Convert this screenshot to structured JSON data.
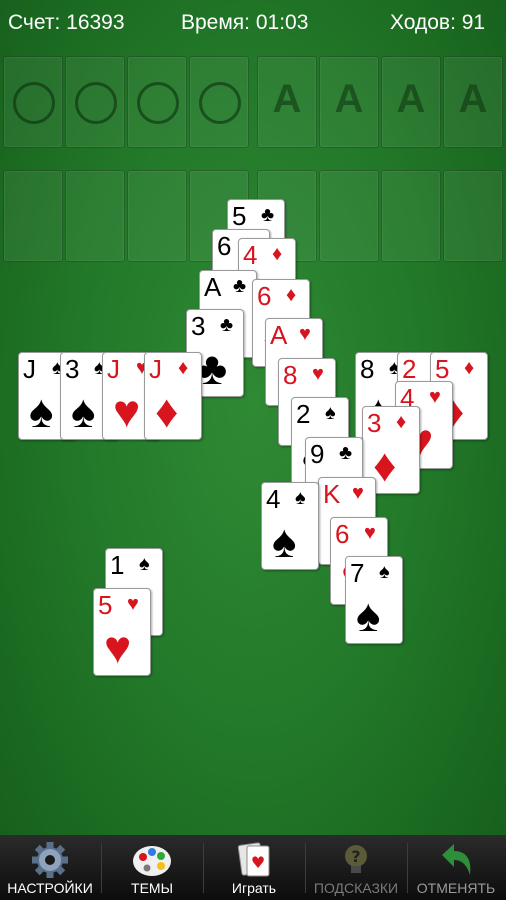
{
  "status": {
    "score": "Счет: 16393",
    "time": "Время: 01:03",
    "moves": "Ходов: 91"
  },
  "freecells": [
    "○",
    "○",
    "○",
    "○"
  ],
  "foundations": [
    "A",
    "A",
    "A",
    "A"
  ],
  "cards": [
    {
      "rank": "5",
      "suit": "♣",
      "color": "black"
    },
    {
      "rank": "6",
      "suit": "♠",
      "color": "black"
    },
    {
      "rank": "4",
      "suit": "♦",
      "color": "red"
    },
    {
      "rank": "A",
      "suit": "♣",
      "color": "black"
    },
    {
      "rank": "6",
      "suit": "♦",
      "color": "red"
    },
    {
      "rank": "3",
      "suit": "♣",
      "color": "black"
    },
    {
      "rank": "A",
      "suit": "♥",
      "color": "red"
    },
    {
      "rank": "J",
      "suit": "♠",
      "color": "black"
    },
    {
      "rank": "3",
      "suit": "♠",
      "color": "black"
    },
    {
      "rank": "J",
      "suit": "♥",
      "color": "red"
    },
    {
      "rank": "J",
      "suit": "♦",
      "color": "red"
    },
    {
      "rank": "8",
      "suit": "♥",
      "color": "red"
    },
    {
      "rank": "8",
      "suit": "♠",
      "color": "black"
    },
    {
      "rank": "2",
      "suit": "♥",
      "color": "red"
    },
    {
      "rank": "5",
      "suit": "♦",
      "color": "red"
    },
    {
      "rank": "4",
      "suit": "♥",
      "color": "red"
    },
    {
      "rank": "2",
      "suit": "♠",
      "color": "black"
    },
    {
      "rank": "3",
      "suit": "♦",
      "color": "red"
    },
    {
      "rank": "9",
      "suit": "♣",
      "color": "black"
    },
    {
      "rank": "K",
      "suit": "♥",
      "color": "red"
    },
    {
      "rank": "4",
      "suit": "♠",
      "color": "black"
    },
    {
      "rank": "6",
      "suit": "♥",
      "color": "red"
    },
    {
      "rank": "7",
      "suit": "♠",
      "color": "black"
    },
    {
      "rank": "1",
      "suit": "♠",
      "color": "black"
    },
    {
      "rank": "5",
      "suit": "♥",
      "color": "red"
    }
  ],
  "toolbar": {
    "settings": {
      "label": "НАСТРОЙКИ",
      "icon": "gear-icon"
    },
    "themes": {
      "label": "ТЕМЫ",
      "icon": "palette-icon"
    },
    "play": {
      "label": "Играть",
      "icon": "cards-icon"
    },
    "hints": {
      "label": "ПОДСКАЗКИ",
      "icon": "lightbulb-icon"
    },
    "undo": {
      "label": "ОТМЕНЯТЬ",
      "icon": "undo-arrow-icon"
    }
  },
  "colors": {
    "felt": "#237a2a",
    "red_suit": "#d8141e",
    "undo_green": "#2e8f3a"
  }
}
